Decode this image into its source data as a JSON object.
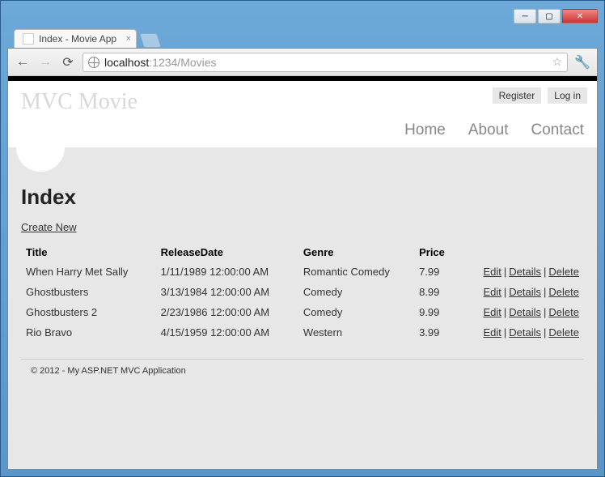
{
  "window": {
    "tab_title": "Index - Movie App"
  },
  "browser": {
    "url_host": "localhost",
    "url_port_path": ":1234/Movies"
  },
  "header": {
    "logo": "MVC Movie",
    "register": "Register",
    "login": "Log in",
    "nav": {
      "home": "Home",
      "about": "About",
      "contact": "Contact"
    }
  },
  "page": {
    "heading": "Index",
    "create_label": "Create New",
    "columns": {
      "title": "Title",
      "release": "ReleaseDate",
      "genre": "Genre",
      "price": "Price"
    },
    "actions": {
      "edit": "Edit",
      "details": "Details",
      "delete": "Delete"
    },
    "rows": [
      {
        "title": "When Harry Met Sally",
        "release": "1/11/1989 12:00:00 AM",
        "genre": "Romantic Comedy",
        "price": "7.99"
      },
      {
        "title": "Ghostbusters",
        "release": "3/13/1984 12:00:00 AM",
        "genre": "Comedy",
        "price": "8.99"
      },
      {
        "title": "Ghostbusters 2",
        "release": "2/23/1986 12:00:00 AM",
        "genre": "Comedy",
        "price": "9.99"
      },
      {
        "title": "Rio Bravo",
        "release": "4/15/1959 12:00:00 AM",
        "genre": "Western",
        "price": "3.99"
      }
    ]
  },
  "footer": {
    "text": "© 2012 - My ASP.NET MVC Application"
  }
}
